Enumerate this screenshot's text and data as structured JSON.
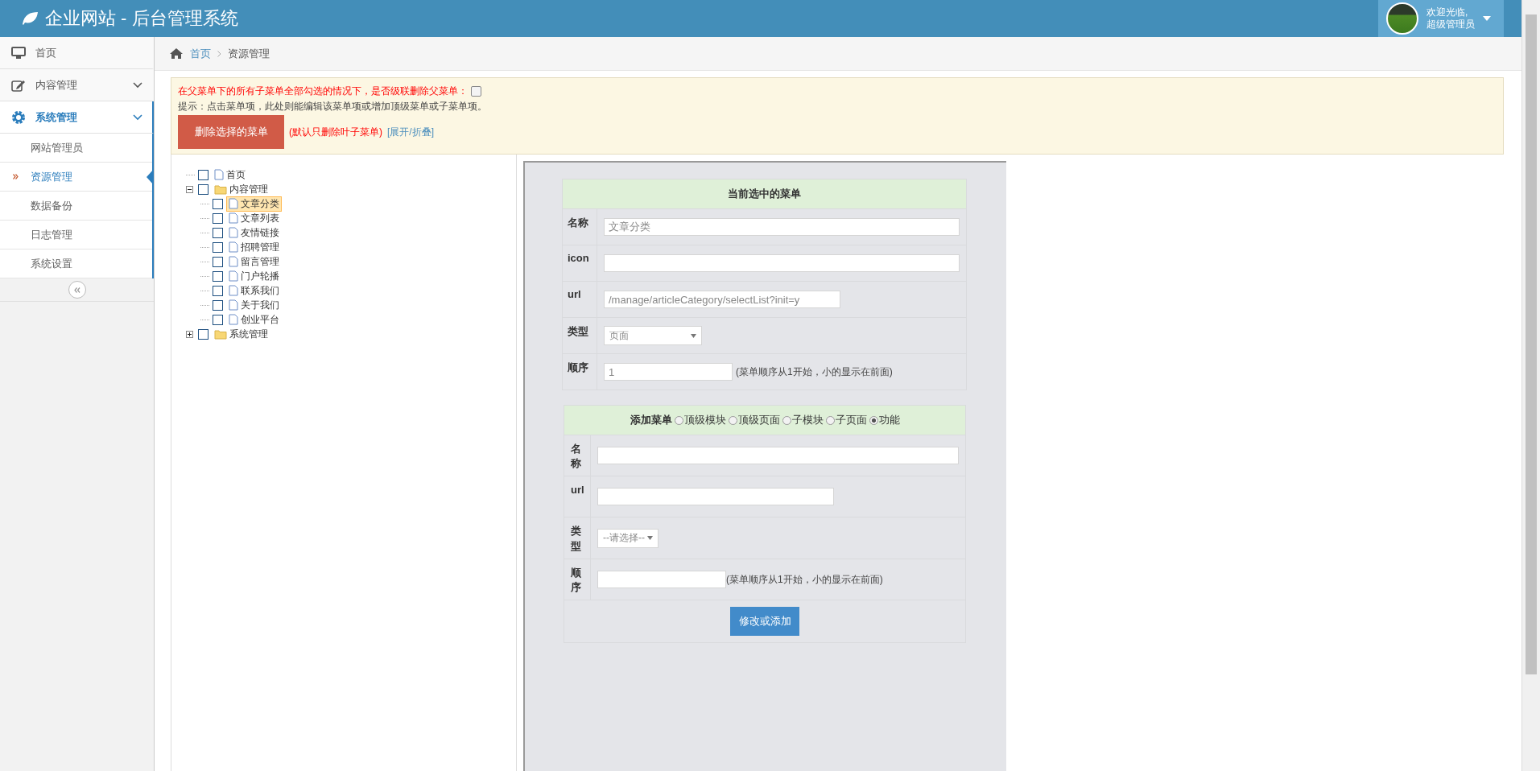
{
  "header": {
    "title": "企业网站 - 后台管理系统",
    "greeting": "欢迎光临,",
    "user": "超级管理员"
  },
  "sidebar": {
    "items": [
      {
        "label": "首页",
        "kind": "link",
        "selected": false
      },
      {
        "label": "内容管理",
        "kind": "group",
        "selected": false
      },
      {
        "label": "系统管理",
        "kind": "group",
        "selected": true,
        "children": [
          {
            "label": "网站管理员",
            "selected": false
          },
          {
            "label": "资源管理",
            "selected": true
          },
          {
            "label": "数据备份",
            "selected": false
          },
          {
            "label": "日志管理",
            "selected": false
          },
          {
            "label": "系统设置",
            "selected": false
          }
        ]
      }
    ]
  },
  "breadcrumb": [
    "首页",
    "资源管理"
  ],
  "notice": {
    "warning": "在父菜单下的所有子菜单全部勾选的情况下，是否级联删除父菜单：",
    "cascade_checked": false,
    "hint": "提示：点击菜单项，此处则能编辑该菜单项或增加顶级菜单或子菜单项。",
    "delete_button": "删除选择的菜单",
    "note": "(默认只删除叶子菜单)",
    "toggle_link": "[展开/折叠]"
  },
  "tree": [
    {
      "label": "首页",
      "kind": "page",
      "checked": false,
      "selected": false
    },
    {
      "label": "内容管理",
      "kind": "folder",
      "checked": false,
      "selected": false,
      "expanded": true,
      "children": [
        {
          "label": "文章分类",
          "kind": "page",
          "checked": false,
          "selected": true
        },
        {
          "label": "文章列表",
          "kind": "page",
          "checked": false,
          "selected": false
        },
        {
          "label": "友情链接",
          "kind": "page",
          "checked": false,
          "selected": false
        },
        {
          "label": "招聘管理",
          "kind": "page",
          "checked": false,
          "selected": false
        },
        {
          "label": "留言管理",
          "kind": "page",
          "checked": false,
          "selected": false
        },
        {
          "label": "门户轮播",
          "kind": "page",
          "checked": false,
          "selected": false
        },
        {
          "label": "联系我们",
          "kind": "page",
          "checked": false,
          "selected": false
        },
        {
          "label": "关于我们",
          "kind": "page",
          "checked": false,
          "selected": false
        },
        {
          "label": "创业平台",
          "kind": "page",
          "checked": false,
          "selected": false
        }
      ]
    },
    {
      "label": "系统管理",
      "kind": "folder",
      "checked": false,
      "selected": false,
      "expanded": false
    }
  ],
  "current_form": {
    "title": "当前选中的菜单",
    "fields": [
      {
        "label": "名称",
        "kind": "text",
        "value": "文章分类"
      },
      {
        "label": "icon",
        "kind": "text"
      },
      {
        "label": "url",
        "kind": "url",
        "value": "/manage/articleCategory/selectList?init=y"
      },
      {
        "label": "类型",
        "kind": "select",
        "value": "页面"
      },
      {
        "label": "顺序",
        "kind": "number",
        "value": "1",
        "note": "(菜单顺序从1开始，小的显示在前面)"
      }
    ]
  },
  "add_form": {
    "title": "添加菜单",
    "options": [
      {
        "label": "顶级模块",
        "selected": false
      },
      {
        "label": "顶级页面",
        "selected": false
      },
      {
        "label": "子模块",
        "selected": false
      },
      {
        "label": "子页面",
        "selected": false
      },
      {
        "label": "功能",
        "selected": true
      }
    ],
    "fields": [
      {
        "label": "名称",
        "kind": "text"
      },
      {
        "label": "url",
        "kind": "url"
      },
      {
        "label": "类型",
        "kind": "select",
        "value": "--请选择--"
      },
      {
        "label": "顺序",
        "kind": "number",
        "note": "(菜单顺序从1开始，小的显示在前面)"
      }
    ],
    "submit": "修改或添加"
  }
}
